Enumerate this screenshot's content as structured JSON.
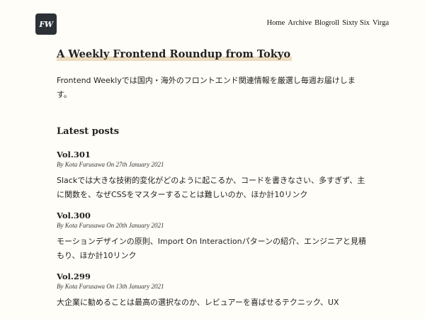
{
  "header": {
    "logo_text": "FW",
    "nav": [
      {
        "label": "Home"
      },
      {
        "label": "Archive"
      },
      {
        "label": "Blogroll"
      },
      {
        "label": "Sixty Six"
      },
      {
        "label": "Virga"
      }
    ]
  },
  "main": {
    "title": "A Weekly Frontend Roundup from Tokyo",
    "intro": "Frontend Weeklyでは国内・海外のフロントエンド関連情報を厳選し毎週お届けします。",
    "latest_heading": "Latest posts",
    "posts": [
      {
        "title": "Vol.301",
        "meta": "By Kota Furusawa On 27th January 2021",
        "summary": "Slackでは大きな技術的変化がどのように起こるか、コードを書きなさい、多すぎず、主に関数を、なぜCSSをマスターすることは難しいのか、ほか計10リンク"
      },
      {
        "title": "Vol.300",
        "meta": "By Kota Furusawa On 20th January 2021",
        "summary": "モーションデザインの原則、Import On Interactionパターンの紹介、エンジニアと見積もり、ほか計10リンク"
      },
      {
        "title": "Vol.299",
        "meta": "By Kota Furusawa On 13th January 2021",
        "summary": "大企業に勧めることは最高の選択なのか、レビュアーを喜ばせるテクニック、UX"
      }
    ]
  },
  "colors": {
    "background": "#fffdf7",
    "logo_bg": "#2b3136",
    "title_highlight": "#ecdcc0",
    "text": "#222222"
  }
}
